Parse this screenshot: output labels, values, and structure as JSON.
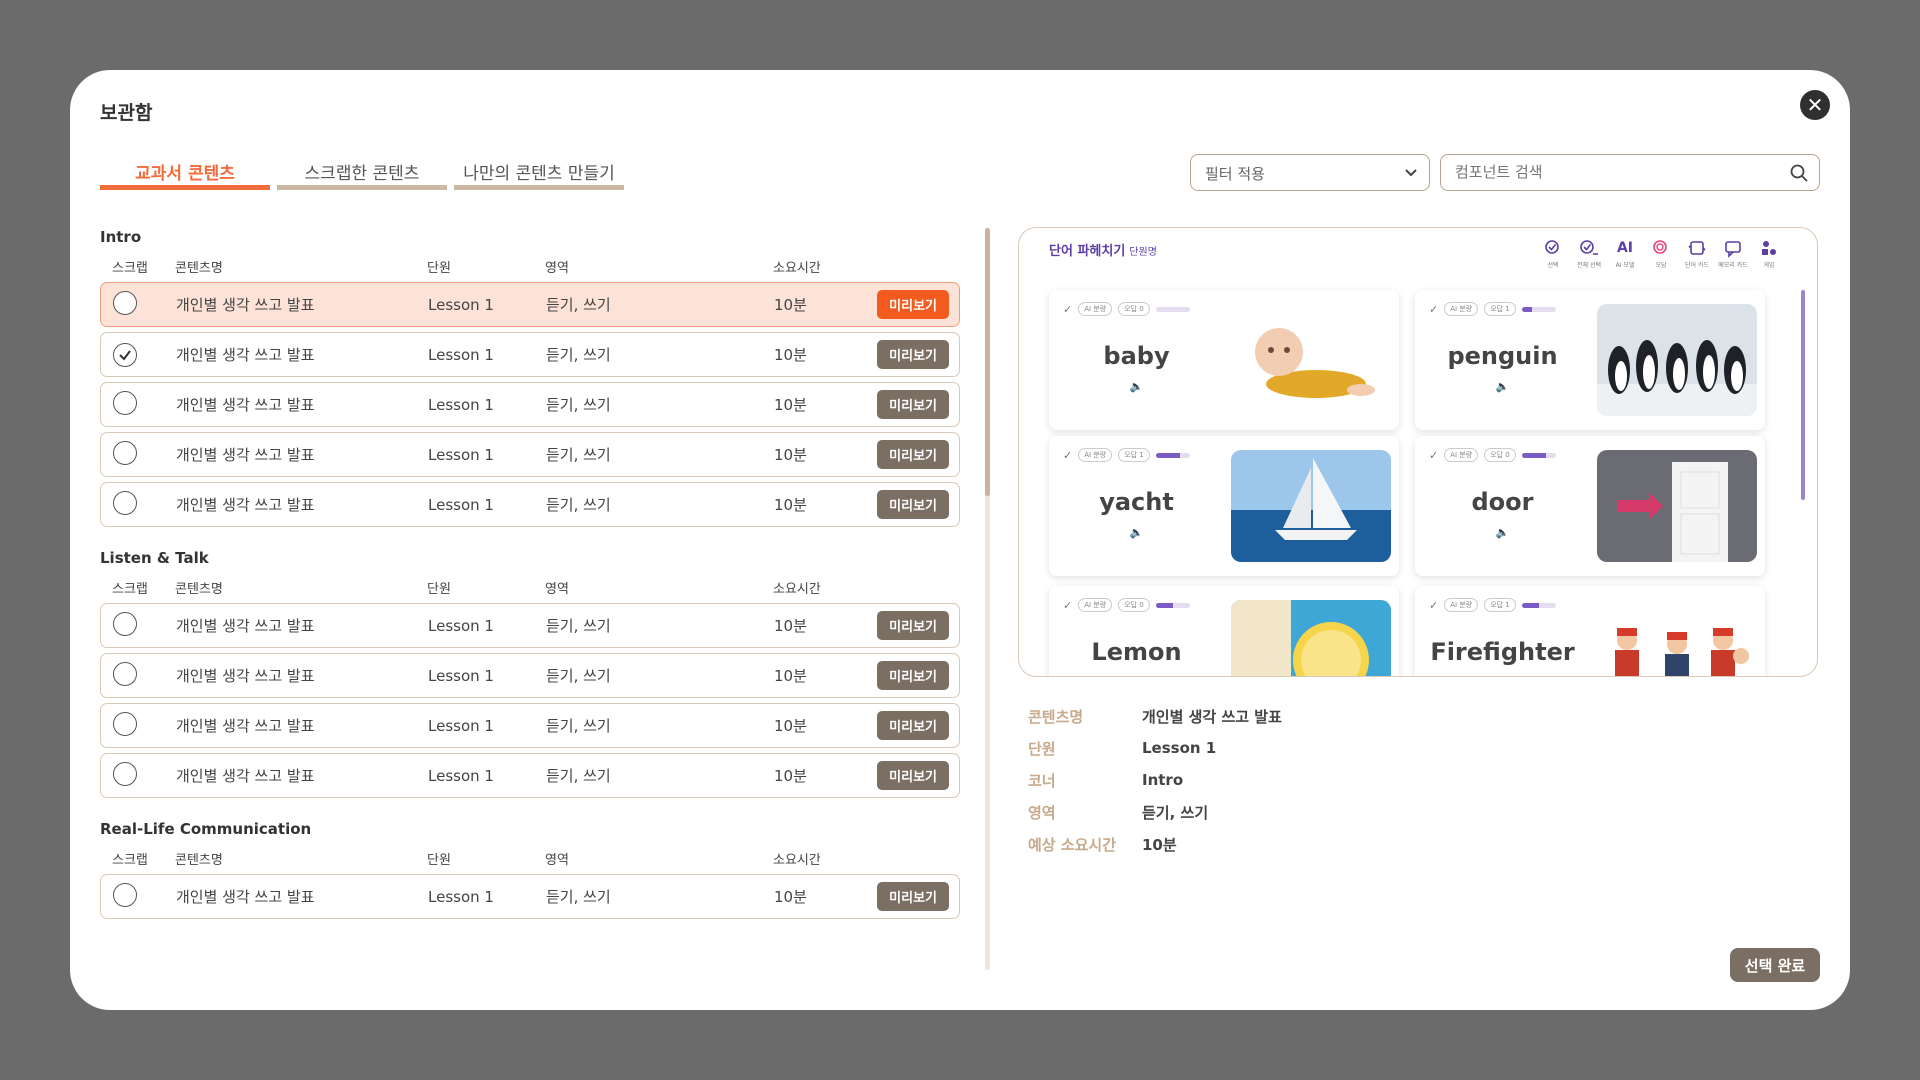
{
  "modal": {
    "title": "보관함",
    "close_icon": "close-icon"
  },
  "tabs": [
    {
      "label": "교과서 콘텐츠",
      "active": true
    },
    {
      "label": "스크랩한 콘텐츠",
      "active": false
    },
    {
      "label": "나만의 콘텐츠 만들기",
      "active": false
    }
  ],
  "filter": {
    "label": "필터 적용"
  },
  "search": {
    "placeholder": "컴포넌트 검색"
  },
  "columns": {
    "scrap": "스크랩",
    "name": "콘텐츠명",
    "unit": "단원",
    "area": "영역",
    "time": "소요시간"
  },
  "preview_label": "미리보기",
  "sections": [
    {
      "title": "Intro",
      "rows": [
        {
          "name": "개인별 생각 쓰고 발표",
          "unit": "Lesson 1",
          "area": "듣기, 쓰기",
          "time": "10분",
          "checked": false,
          "selected": true
        },
        {
          "name": "개인별 생각 쓰고 발표",
          "unit": "Lesson 1",
          "area": "듣기, 쓰기",
          "time": "10분",
          "checked": true,
          "selected": false
        },
        {
          "name": "개인별 생각 쓰고 발표",
          "unit": "Lesson 1",
          "area": "듣기, 쓰기",
          "time": "10분",
          "checked": false,
          "selected": false
        },
        {
          "name": "개인별 생각 쓰고 발표",
          "unit": "Lesson 1",
          "area": "듣기, 쓰기",
          "time": "10분",
          "checked": false,
          "selected": false
        },
        {
          "name": "개인별 생각 쓰고 발표",
          "unit": "Lesson 1",
          "area": "듣기, 쓰기",
          "time": "10분",
          "checked": false,
          "selected": false
        }
      ]
    },
    {
      "title": "Listen & Talk",
      "rows": [
        {
          "name": "개인별 생각 쓰고 발표",
          "unit": "Lesson 1",
          "area": "듣기, 쓰기",
          "time": "10분",
          "checked": false,
          "selected": false
        },
        {
          "name": "개인별 생각 쓰고 발표",
          "unit": "Lesson 1",
          "area": "듣기, 쓰기",
          "time": "10분",
          "checked": false,
          "selected": false
        },
        {
          "name": "개인별 생각 쓰고 발표",
          "unit": "Lesson 1",
          "area": "듣기, 쓰기",
          "time": "10분",
          "checked": false,
          "selected": false
        },
        {
          "name": "개인별 생각 쓰고 발표",
          "unit": "Lesson 1",
          "area": "듣기, 쓰기",
          "time": "10분",
          "checked": false,
          "selected": false
        }
      ]
    },
    {
      "title": "Real-Life Communication",
      "rows": [
        {
          "name": "개인별 생각 쓰고 발표",
          "unit": "Lesson 1",
          "area": "듣기, 쓰기",
          "time": "10분",
          "checked": false,
          "selected": false
        }
      ]
    }
  ],
  "preview": {
    "title": "단어 파헤치기",
    "subtitle": "단원명",
    "tools": [
      {
        "label": "선택",
        "icon": "check-circle-icon"
      },
      {
        "label": "전체 선택",
        "icon": "check-all-icon"
      },
      {
        "label": "AI 모델",
        "icon": "ai-icon",
        "text": "AI"
      },
      {
        "label": "오답",
        "icon": "wrong-answer-icon"
      },
      {
        "label": "단어 카드",
        "icon": "word-card-icon"
      },
      {
        "label": "메모리 카드",
        "icon": "memory-card-icon"
      },
      {
        "label": "게임",
        "icon": "game-icon"
      }
    ],
    "cards": [
      {
        "word": "baby",
        "image": "baby-image",
        "ai": "AI 분량",
        "wrong": "오답 0",
        "progress": 0.0
      },
      {
        "word": "penguin",
        "image": "penguin-image",
        "ai": "AI 분량",
        "wrong": "오답 1",
        "progress": 0.3
      },
      {
        "word": "yacht",
        "image": "yacht-image",
        "ai": "AI 분량",
        "wrong": "오답 1",
        "progress": 0.7
      },
      {
        "word": "door",
        "image": "door-image",
        "ai": "AI 분량",
        "wrong": "오답 0",
        "progress": 0.7
      },
      {
        "word": "Lemon",
        "image": "lemon-image",
        "ai": "AI 분량",
        "wrong": "오답 0",
        "progress": 0.5
      },
      {
        "word": "Firefighter",
        "image": "firefighter-image",
        "ai": "AI 분량",
        "wrong": "오답 1",
        "progress": 0.5
      }
    ]
  },
  "details": [
    {
      "label": "콘텐츠명",
      "value": "개인별 생각 쓰고 발표"
    },
    {
      "label": "단원",
      "value": "Lesson 1"
    },
    {
      "label": "코너",
      "value": "Intro"
    },
    {
      "label": "영역",
      "value": "듣기, 쓰기"
    },
    {
      "label": "예상 소요시간",
      "value": "10분"
    }
  ],
  "done_button": "선택 완료",
  "colors": {
    "accent": "#f26b3a",
    "brown": "#7b6e63",
    "purple": "#5b3fa6"
  }
}
